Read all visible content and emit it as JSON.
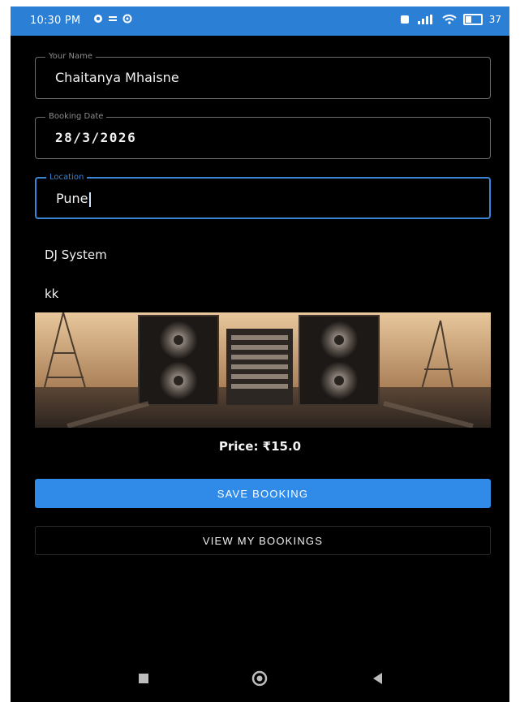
{
  "status_bar": {
    "time": "10:30 PM",
    "battery_text": "37",
    "icons": [
      "whatsapp-icon",
      "menu-icon",
      "settings-icon",
      "sim-icon",
      "signal-icon",
      "wifi-icon",
      "battery-icon"
    ]
  },
  "form": {
    "name": {
      "label": "Your Name",
      "value": "Chaitanya Mhaisne"
    },
    "date": {
      "label": "Booking Date",
      "value": "28/3/2026"
    },
    "location": {
      "label": "Location",
      "value": "Pune"
    }
  },
  "service": {
    "title": "DJ System",
    "subtitle": "kk",
    "image_icon": "dj-speaker-image",
    "price_text": "Price: ₹15.0"
  },
  "buttons": {
    "save": "SAVE BOOKING",
    "view": "VIEW MY BOOKINGS"
  },
  "nav": {
    "items": [
      "recent-apps-icon",
      "home-icon",
      "back-icon"
    ]
  },
  "colors": {
    "status_bar": "#2b7fd4",
    "accent": "#2f8ae8",
    "background": "#000000",
    "text": "#f2f2f2"
  }
}
